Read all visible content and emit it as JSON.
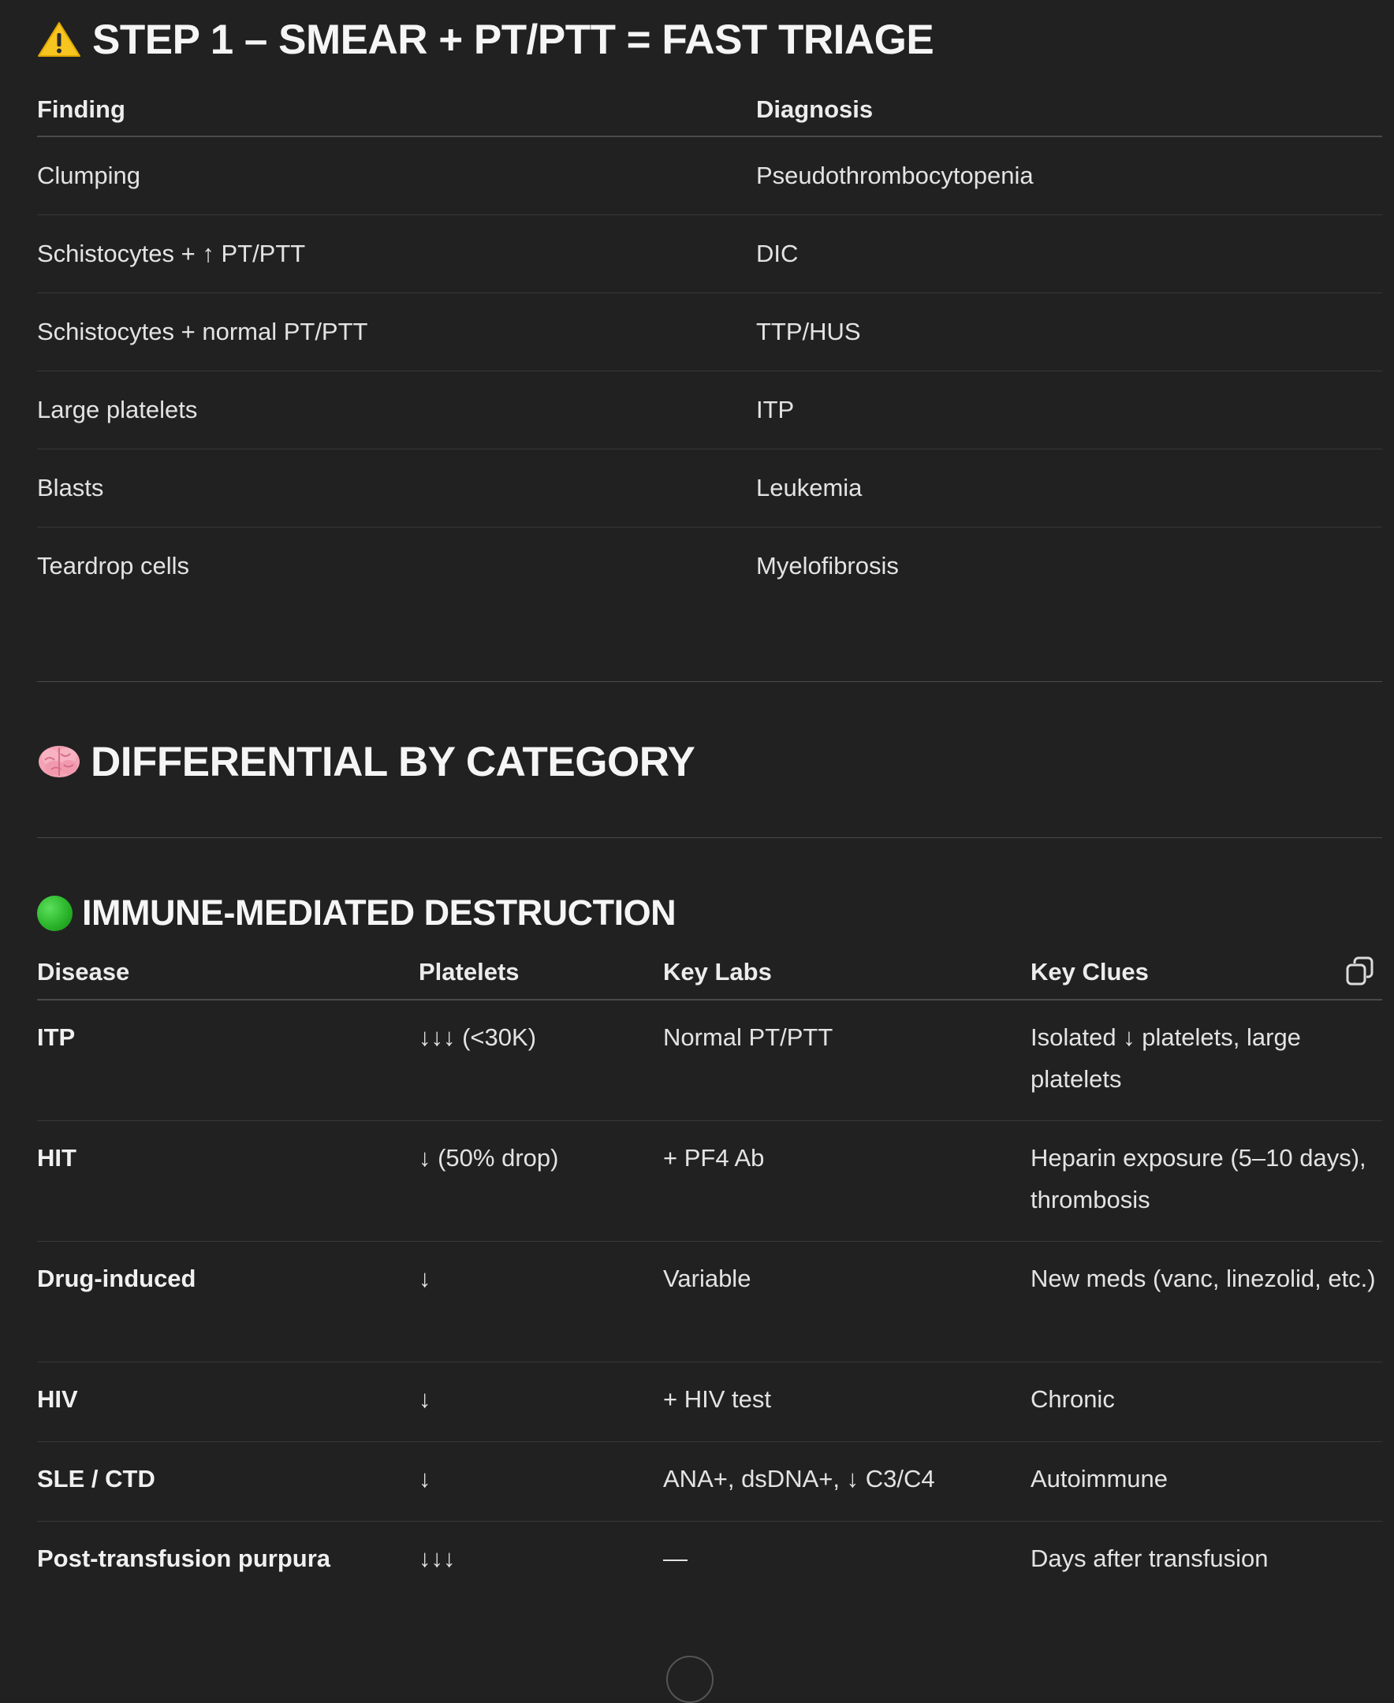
{
  "step1": {
    "title": "STEP 1 – SMEAR + PT/PTT = FAST TRIAGE",
    "icon": "warning-icon",
    "columns": [
      "Finding",
      "Diagnosis"
    ],
    "rows": [
      {
        "finding": "Clumping",
        "diagnosis": "Pseudothrombocytopenia"
      },
      {
        "finding": "Schistocytes + ↑ PT/PTT",
        "diagnosis": "DIC"
      },
      {
        "finding": "Schistocytes + normal PT/PTT",
        "diagnosis": "TTP/HUS"
      },
      {
        "finding": "Large platelets",
        "diagnosis": "ITP"
      },
      {
        "finding": "Blasts",
        "diagnosis": "Leukemia"
      },
      {
        "finding": "Teardrop cells",
        "diagnosis": "Myelofibrosis"
      }
    ]
  },
  "differential": {
    "title": "DIFFERENTIAL BY CATEGORY",
    "icon": "brain-icon"
  },
  "immune": {
    "title": "IMMUNE-MEDIATED DESTRUCTION",
    "icon": "green-circle-icon",
    "columns": [
      "Disease",
      "Platelets",
      "Key Labs",
      "Key Clues"
    ],
    "rows": [
      {
        "disease": "ITP",
        "platelets": "↓↓↓ (<30K)",
        "labs": "Normal PT/PTT",
        "clues": "Isolated ↓ platelets, large platelets"
      },
      {
        "disease": "HIT",
        "platelets": "↓ (50% drop)",
        "labs": "+ PF4 Ab",
        "clues": "Heparin exposure (5–10 days), thrombosis"
      },
      {
        "disease": "Drug-induced",
        "platelets": "↓",
        "labs": "Variable",
        "clues": "New meds (vanc, linezolid, etc.)"
      },
      {
        "disease": "HIV",
        "platelets": "↓",
        "labs": "+ HIV test",
        "clues": "Chronic"
      },
      {
        "disease": "SLE / CTD",
        "platelets": "↓",
        "labs": "ANA+, dsDNA+, ↓ C3/C4",
        "clues": "Autoimmune"
      },
      {
        "disease": "Post-transfusion purpura",
        "platelets": "↓↓↓",
        "labs": "—",
        "clues": "Days after transfusion"
      }
    ]
  },
  "colors": {
    "background": "#212121",
    "text": "#ececec",
    "divider": "#4a4a4a"
  }
}
